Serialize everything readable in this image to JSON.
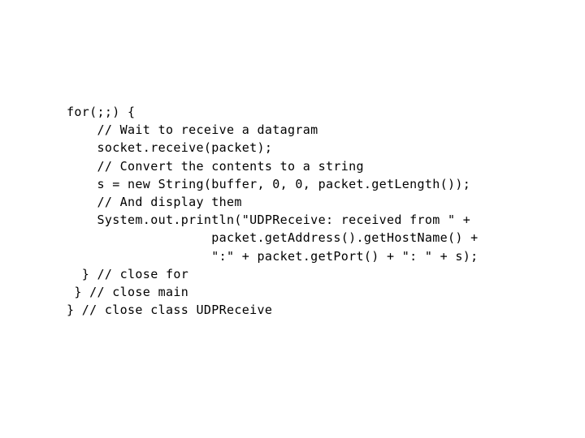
{
  "slide": {
    "background_color": "#ffffff",
    "text_color": "#000000",
    "language": "java",
    "code_lines": [
      "for(;;) {",
      "    // Wait to receive a datagram",
      "    socket.receive(packet);",
      "    // Convert the contents to a string",
      "    s = new String(buffer, 0, 0, packet.getLength());",
      "    // And display them",
      "    System.out.println(\"UDPReceive: received from \" +",
      "                   packet.getAddress().getHostName() +",
      "                   \":\" + packet.getPort() + \": \" + s);",
      "  } // close for",
      " } // close main",
      "} // close class UDPReceive"
    ]
  }
}
